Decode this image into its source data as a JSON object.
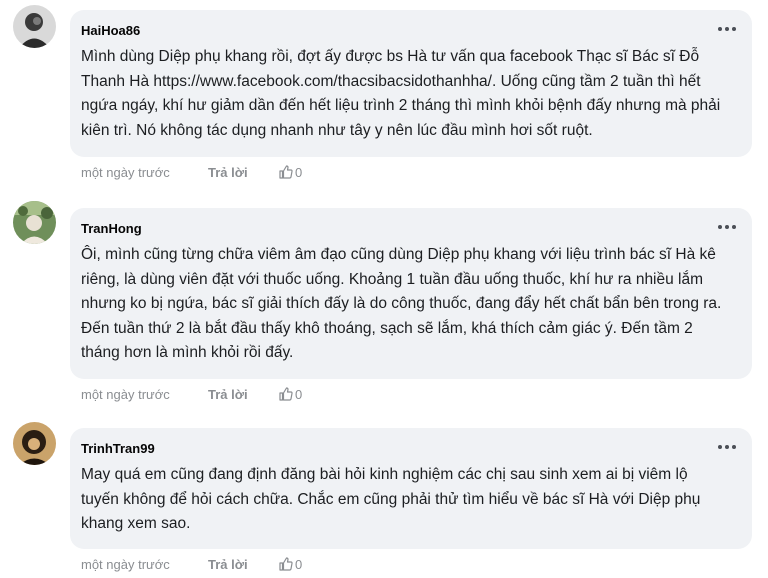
{
  "comments": [
    {
      "author": "HaiHoa86",
      "text": "Mình dùng Diệp phụ khang rồi, đợt ấy được bs Hà tư vấn qua facebook Thạc sĩ Bác sĩ Đỗ Thanh Hà https://www.facebook.com/thacsibacsidothanhha/. Uống cũng tầm 2 tuần thì hết ngứa ngáy, khí hư giảm dần đến hết liệu trình 2 tháng thì mình khỏi bệnh đấy nhưng mà phải kiên trì. Nó không tác dụng nhanh như tây y nên lúc đầu mình hơi sốt ruột.",
      "time": "một ngày trước",
      "reply": "Trả lời",
      "likes": "0"
    },
    {
      "author": "TranHong",
      "text": "Ôi, mình cũng từng chữa viêm âm đạo cũng dùng Diệp phụ khang với liệu trình bác sĩ Hà kê riêng, là dùng viên đặt với thuốc uống. Khoảng 1 tuần đầu uống thuốc, khí hư ra nhiều lắm nhưng ko bị ngứa, bác sĩ giải thích đấy là do công thuốc, đang đẩy hết chất bẩn bên trong ra. Đến tuần thứ 2 là bắt đầu thấy khô thoáng, sạch sẽ lắm, khá thích cảm giác ý. Đến tầm 2 tháng hơn là mình khỏi rồi đấy.",
      "time": "một ngày trước",
      "reply": "Trả lời",
      "likes": "0"
    },
    {
      "author": "TrinhTran99",
      "text": "May quá em cũng đang định đăng bài hỏi kinh nghiệm các chị sau sinh xem ai bị viêm lộ tuyến không để hỏi cách chữa. Chắc em cũng phải thử tìm hiểu về bác sĩ Hà với Diệp phụ khang xem sao.",
      "time": "một ngày trước",
      "reply": "Trả lời",
      "likes": "0"
    }
  ]
}
